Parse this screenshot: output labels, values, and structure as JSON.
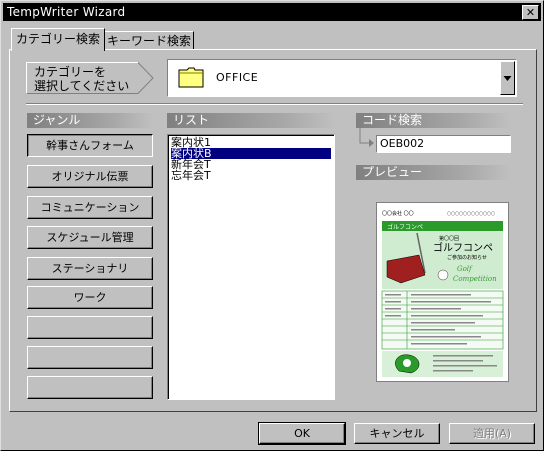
{
  "window": {
    "title": "TempWriter Wizard",
    "close_glyph": "✕"
  },
  "tabs": [
    {
      "label": "カテゴリー検索",
      "active": true
    },
    {
      "label": "キーワード検索",
      "active": false
    }
  ],
  "category": {
    "prompt_line1": "カテゴリーを",
    "prompt_line2": "選択してください",
    "selected": "OFFICE",
    "icon": "folder-icon"
  },
  "genre": {
    "header": "ジャンル",
    "buttons": [
      "幹事さんフォーム",
      "オリジナル伝票",
      "コミュニケーション",
      "スケジュール管理",
      "ステーショナリ",
      "ワーク",
      "",
      "",
      ""
    ],
    "selected_index": 0
  },
  "list": {
    "header": "リスト",
    "items": [
      "案内状1",
      "案内状B",
      "新年会T",
      "忘年会T"
    ],
    "selected_index": 1
  },
  "code": {
    "header": "コード検索",
    "value": "OEB002"
  },
  "preview": {
    "header": "プレビュー",
    "doc_top_left": "〇〇会社 〇〇",
    "doc_top_right": "〇〇〇〇〇〇〇〇〇〇〇〇",
    "doc_banner": "ゴルフコンペ",
    "doc_kicker": "第〇〇回",
    "doc_title": "ゴルフコンペ",
    "doc_sub": "ご参加のお知らせ",
    "doc_script1": "Golf",
    "doc_script2": "Competition"
  },
  "footer": {
    "ok": "OK",
    "cancel": "キャンセル",
    "apply": "適用(A)",
    "apply_enabled": false
  },
  "colors": {
    "face": "#c0c0c0",
    "selection": "#000080",
    "title_bar": "#000000",
    "doc_green": "#2a9a2a"
  }
}
